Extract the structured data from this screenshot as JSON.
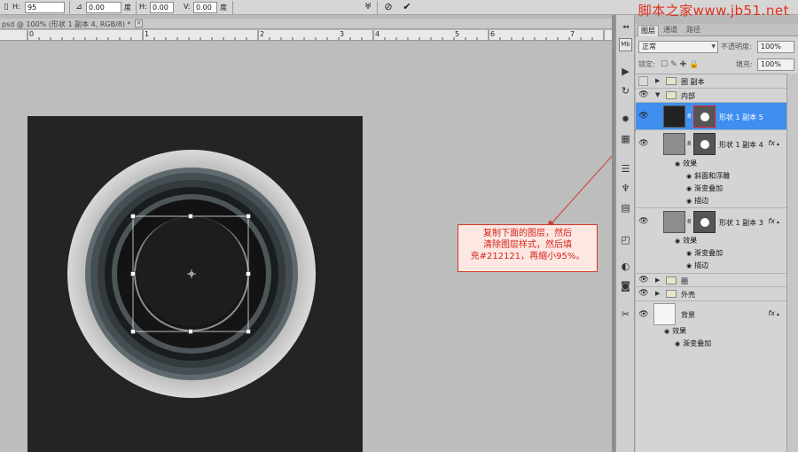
{
  "options_bar": {
    "h_label": "H:",
    "h_value": "95",
    "angle_value": "0.00",
    "deg1": "度",
    "hskew_label": "H:",
    "hskew_value": "0.00",
    "deg2": "度",
    "vskew_label": "V:",
    "vskew_value": "0.00",
    "deg3": "度"
  },
  "watermark": "脚本之家www.jb51.net",
  "document": {
    "tab_title": "psd @ 100% (形状 1 副本 4, RGB/8) *",
    "ruler_numbers": [
      "0",
      "1",
      "2",
      "3",
      "4",
      "5",
      "6",
      "7"
    ]
  },
  "annotation": {
    "line1": "复制下面的图层，然后",
    "line2": "清除图层样式，然后填",
    "line3": "充#212121，再缩小95%。"
  },
  "layers_panel": {
    "tabs": [
      "图层",
      "通道",
      "路径"
    ],
    "blend_mode": "正常",
    "opacity_label": "不透明度:",
    "opacity_value": "100%",
    "lock_label": "锁定:",
    "fill_label": "填充:",
    "fill_value": "100%",
    "layers": [
      {
        "name": "圈 副本"
      },
      {
        "name": "内部"
      },
      {
        "name": "形状 1 副本 5"
      },
      {
        "name": "形状 1 副本 4",
        "effects_title": "效果",
        "effects": [
          "斜面和浮雕",
          "渐变叠加",
          "描边"
        ]
      },
      {
        "name": "形状 1 副本 3",
        "effects_title": "效果",
        "effects": [
          "渐变叠加",
          "描边"
        ]
      },
      {
        "name": "圈"
      },
      {
        "name": "外壳"
      },
      {
        "name": "背景",
        "effects_title": "效果",
        "effects": [
          "渐变叠加"
        ]
      }
    ]
  },
  "colors": {
    "selection": "#3f8ff0",
    "annotation_red": "#d23a2c",
    "artboard": "#242424"
  }
}
